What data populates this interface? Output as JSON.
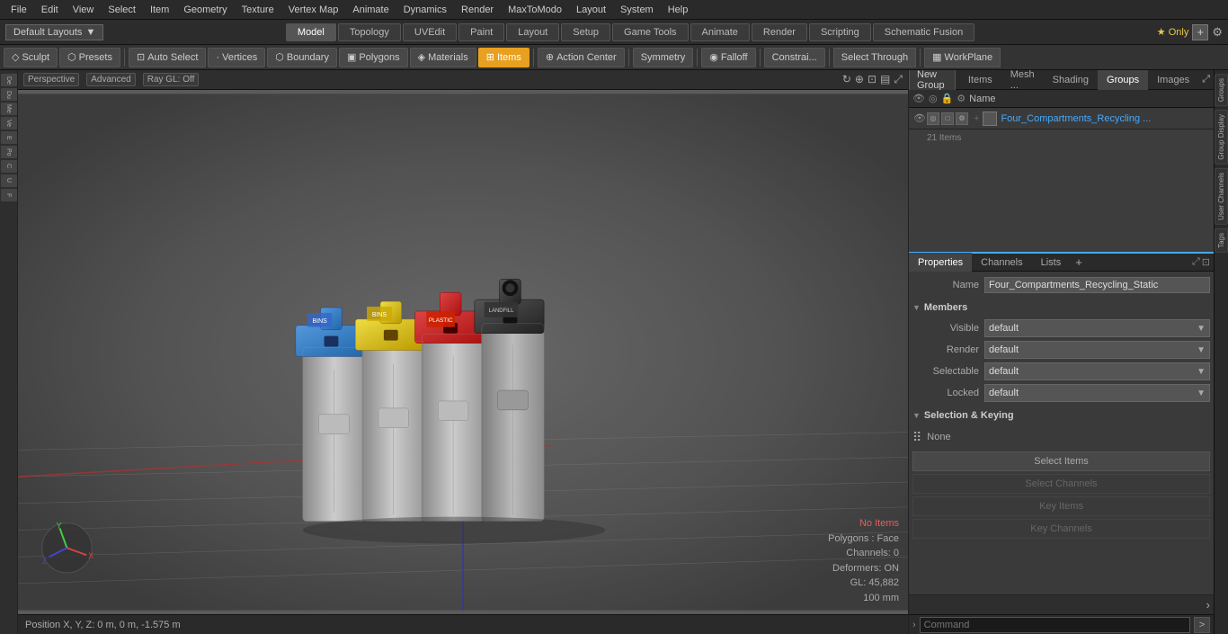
{
  "menus": {
    "items": [
      "File",
      "Edit",
      "View",
      "Select",
      "Item",
      "Geometry",
      "Texture",
      "Vertex Map",
      "Animate",
      "Dynamics",
      "Render",
      "MaxToModo",
      "Layout",
      "System",
      "Help"
    ]
  },
  "layout_bar": {
    "dropdown_label": "Default Layouts",
    "tabs": [
      "Model",
      "Topology",
      "UVEdit",
      "Paint",
      "Layout",
      "Setup",
      "Game Tools",
      "Animate",
      "Render",
      "Scripting",
      "Schematic Fusion"
    ],
    "active_tab": "Model",
    "star_label": "★ Only",
    "plus_label": "+"
  },
  "toolbar": {
    "sculpt_label": "Sculpt",
    "presets_label": "Presets",
    "auto_select_label": "Auto Select",
    "vertices_label": "Vertices",
    "boundary_label": "Boundary",
    "polygons_label": "Polygons",
    "materials_label": "Materials",
    "items_label": "Items",
    "action_center_label": "Action Center",
    "symmetry_label": "Symmetry",
    "falloff_label": "Falloff",
    "constraints_label": "Constrai...",
    "select_through_label": "Select Through",
    "work_plane_label": "WorkPlane"
  },
  "viewport": {
    "perspective_label": "Perspective",
    "advanced_label": "Advanced",
    "ray_gl_label": "Ray GL: Off",
    "info": {
      "no_items": "No Items",
      "polygons_face": "Polygons : Face",
      "channels": "Channels: 0",
      "deformers": "Deformers: ON",
      "gl": "GL: 45,882",
      "mm": "100 mm"
    }
  },
  "status_bar": {
    "position_label": "Position X, Y, Z:  0 m, 0 m, -1.575 m"
  },
  "right_panel": {
    "top_tabs": [
      "Items",
      "Mesh ...",
      "Shading",
      "Groups",
      "Images"
    ],
    "active_top_tab": "Groups",
    "new_group_label": "New Group",
    "groups_header_name": "Name",
    "group_item": {
      "name": "Four_Compartments_Recycling ...",
      "count": "21 Items"
    },
    "properties_tabs": [
      "Properties",
      "Channels",
      "Lists"
    ],
    "active_prop_tab": "Properties",
    "name_label": "Name",
    "name_value": "Four_Compartments_Recycling_Static",
    "members_section": "Members",
    "visible_label": "Visible",
    "visible_value": "default",
    "render_label": "Render",
    "render_value": "default",
    "selectable_label": "Selectable",
    "selectable_value": "default",
    "locked_label": "Locked",
    "locked_value": "default",
    "sel_keying_section": "Selection & Keying",
    "sel_none_label": "None",
    "btn_select_items": "Select Items",
    "btn_select_channels": "Select Channels",
    "btn_key_items": "Key Items",
    "btn_key_channels": "Key Channels"
  },
  "side_tabs": [
    "Groups",
    "Group Display",
    "User Channels",
    "Tags"
  ],
  "command_bar": {
    "placeholder": "Command",
    "arrow_label": ">"
  },
  "left_icons": [
    "De...",
    "Du...",
    "Me...",
    "Ve...",
    "E...",
    "Po...",
    "C...",
    "U...",
    "F..."
  ]
}
